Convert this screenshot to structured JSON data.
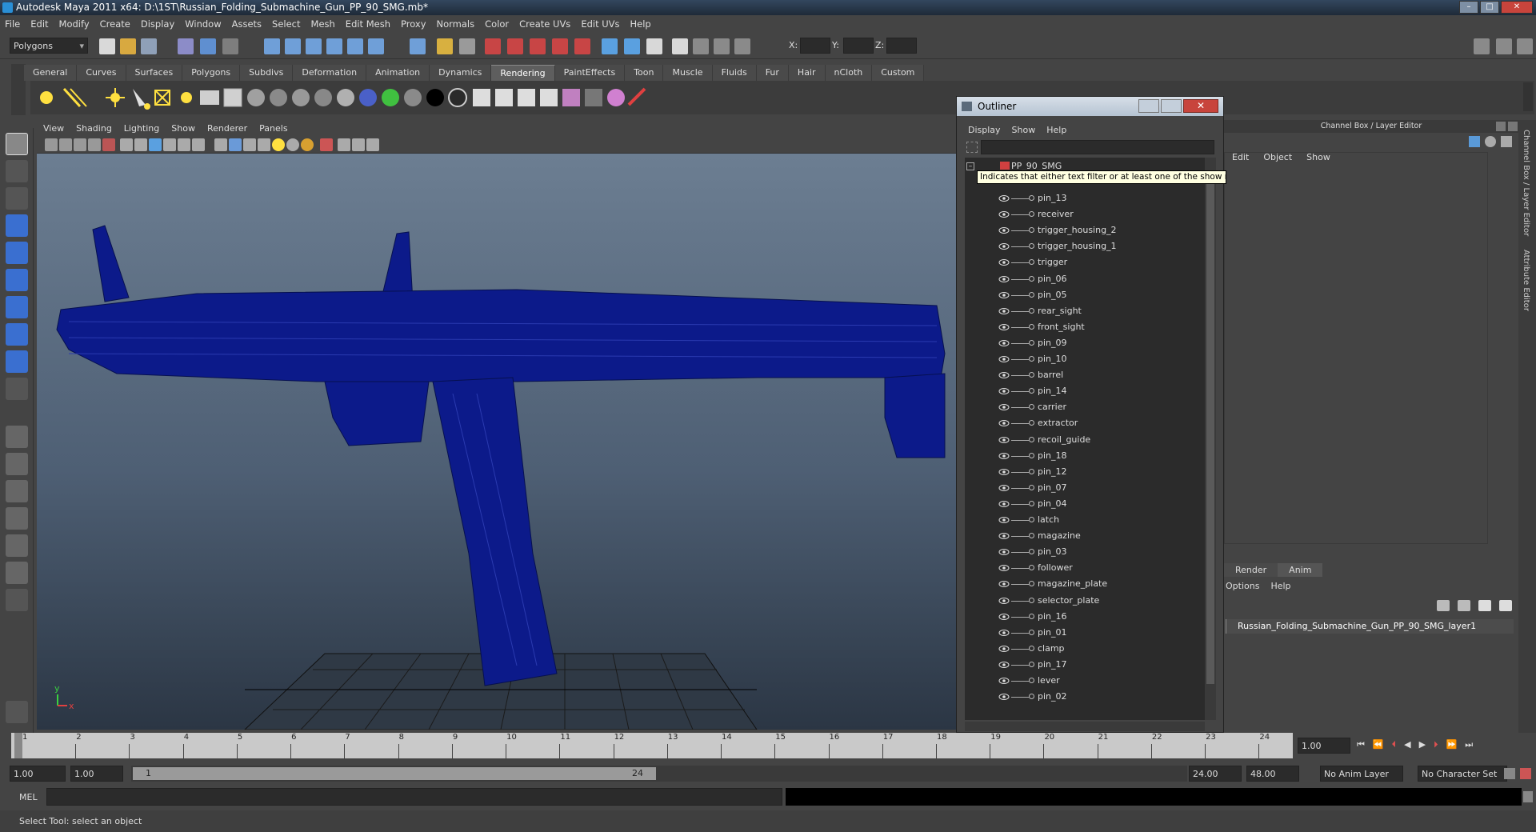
{
  "window": {
    "title": "Autodesk Maya 2011 x64: D:\\1ST\\Russian_Folding_Submachine_Gun_PP_90_SMG.mb*"
  },
  "menubar": [
    "File",
    "Edit",
    "Modify",
    "Create",
    "Display",
    "Window",
    "Assets",
    "Select",
    "Mesh",
    "Edit Mesh",
    "Proxy",
    "Normals",
    "Color",
    "Create UVs",
    "Edit UVs",
    "Help"
  ],
  "status": {
    "mode": "Polygons",
    "x_label": "X:",
    "y_label": "Y:",
    "z_label": "Z:"
  },
  "shelf_tabs": [
    "General",
    "Curves",
    "Surfaces",
    "Polygons",
    "Subdivs",
    "Deformation",
    "Animation",
    "Dynamics",
    "Rendering",
    "PaintEffects",
    "Toon",
    "Muscle",
    "Fluids",
    "Fur",
    "Hair",
    "nCloth",
    "Custom"
  ],
  "active_shelf_tab": "Rendering",
  "viewport": {
    "menu": [
      "View",
      "Shading",
      "Lighting",
      "Show",
      "Renderer",
      "Panels"
    ],
    "axis_y": "y",
    "axis_x": "x",
    "wire_color": "#0c1a8a"
  },
  "outliner": {
    "title": "Outliner",
    "menu": [
      "Display",
      "Show",
      "Help"
    ],
    "root": "PP_90_SMG",
    "tooltip": "Indicates that either text filter or at least one of the show menu",
    "items": [
      "pin_13",
      "receiver",
      "trigger_housing_2",
      "trigger_housing_1",
      "trigger",
      "pin_06",
      "pin_05",
      "rear_sight",
      "front_sight",
      "pin_09",
      "pin_10",
      "barrel",
      "pin_14",
      "carrier",
      "extractor",
      "recoil_guide",
      "pin_18",
      "pin_12",
      "pin_07",
      "pin_04",
      "latch",
      "magazine",
      "pin_03",
      "follower",
      "magazine_plate",
      "selector_plate",
      "pin_16",
      "pin_01",
      "clamp",
      "pin_17",
      "lever",
      "pin_02"
    ]
  },
  "channel_box": {
    "title": "Channel Box / Layer Editor",
    "menu": [
      "Edit",
      "Object",
      "Show"
    ]
  },
  "layer_editor": {
    "tabs": [
      "Render",
      "Anim"
    ],
    "menu": [
      "Options",
      "Help"
    ],
    "layer_name": "Russian_Folding_Submachine_Gun_PP_90_SMG_layer1"
  },
  "side_tabs": [
    "Channel Box / Layer Editor",
    "Attribute Editor"
  ],
  "timeline": {
    "ticks": [
      "1",
      "2",
      "3",
      "4",
      "5",
      "6",
      "7",
      "8",
      "9",
      "10",
      "11",
      "12",
      "13",
      "14",
      "15",
      "16",
      "17",
      "18",
      "19",
      "20",
      "21",
      "22",
      "23",
      "24"
    ],
    "current_frame": "1.00"
  },
  "range": {
    "start": "1.00",
    "playback_start": "1.00",
    "slider_start": "1",
    "slider_end": "24",
    "playback_end": "24.00",
    "end": "48.00",
    "anim_layer": "No Anim Layer",
    "character_set": "No Character Set"
  },
  "command": {
    "label": "MEL"
  },
  "help_line": "Select Tool: select an object"
}
